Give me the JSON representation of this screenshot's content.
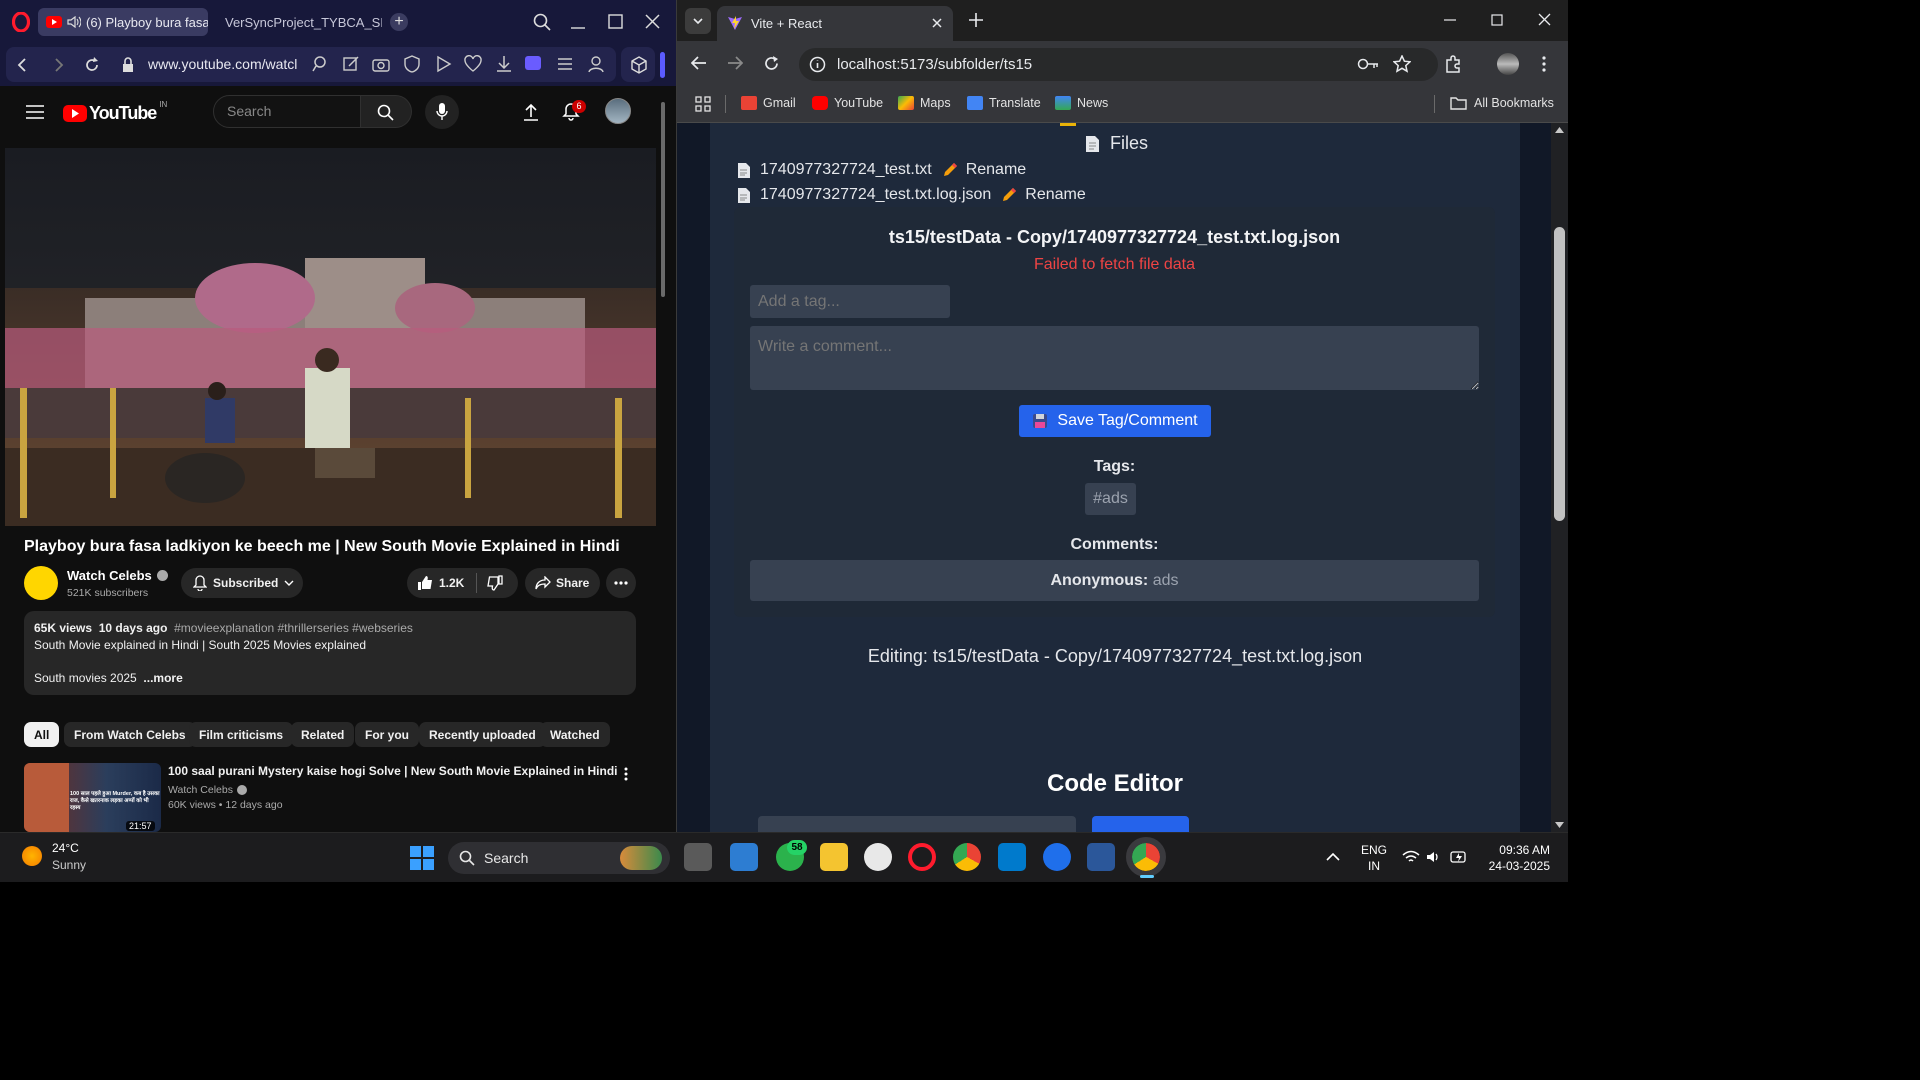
{
  "opera": {
    "tabs": [
      {
        "title": "(6) Playboy bura fasa l"
      },
      {
        "title": "VerSyncProject_TYBCA_SE"
      }
    ],
    "address": "www.youtube.com/watcl"
  },
  "youtube": {
    "logo_text": "YouTube",
    "region": "IN",
    "search_placeholder": "Search",
    "notification_count": "6",
    "video_title": "Playboy bura fasa ladkiyon ke beech me | New South Movie Explained in Hindi",
    "channel_name": "Watch Celebs",
    "subscribers": "521K subscribers",
    "subscribed_label": "Subscribed",
    "like_count": "1.2K",
    "share_label": "Share",
    "views": "65K views",
    "posted": "10 days ago",
    "hashtags": "#movieexplanation #thrillerseries #webseries",
    "description_line1": "South Movie explained in Hindi | South 2025 Movies explained",
    "description_line2": "South movies 2025",
    "more_label": "...more",
    "chips": [
      "All",
      "From Watch Celebs",
      "Film criticisms",
      "Related",
      "For you",
      "Recently uploaded",
      "Watched"
    ],
    "recommendation": {
      "title": "100 saal purani Mystery kaise hogi Solve | New South Movie Explained in Hindi",
      "channel": "Watch Celebs",
      "meta": "60K views • 12 days ago",
      "duration": "21:57",
      "thumb_text": "100 साल पहले हुआ Murder, कब है उसका राज, कैसे खतरनाक लड़का अप्पों को भी रहस्य"
    }
  },
  "chrome": {
    "tab_title": "Vite + React",
    "url": "localhost:5173/subfolder/ts15",
    "bookmarks": [
      {
        "label": "Gmail",
        "color": "#ea4335"
      },
      {
        "label": "YouTube",
        "color": "#ff0000"
      },
      {
        "label": "Maps",
        "color": "#34a853"
      },
      {
        "label": "Translate",
        "color": "#4285f4"
      },
      {
        "label": "News",
        "color": "#4285f4"
      }
    ],
    "all_bookmarks": "All Bookmarks"
  },
  "app": {
    "files_heading": "Files",
    "files": [
      {
        "name": "1740977327724_test.txt",
        "rename": "Rename"
      },
      {
        "name": "1740977327724_test.txt.log.json",
        "rename": "Rename"
      }
    ],
    "card_title": "ts15/testData - Copy/1740977327724_test.txt.log.json",
    "error": "Failed to fetch file data",
    "tag_placeholder": "Add a tag...",
    "comment_placeholder": "Write a comment...",
    "save_button": "Save Tag/Comment",
    "tags_label": "Tags:",
    "tags": [
      "#ads"
    ],
    "comments_label": "Comments:",
    "comments": [
      {
        "author": "Anonymous:",
        "text": "ads"
      }
    ],
    "editing": "Editing: ts15/testData - Copy/1740977327724_test.txt.log.json",
    "code_editor_heading": "Code Editor"
  },
  "taskbar": {
    "temperature": "24°C",
    "weather": "Sunny",
    "search_label": "Search",
    "whatsapp_badge": "58",
    "lang_top": "ENG",
    "lang_bottom": "IN",
    "time": "09:36 AM",
    "date": "24-03-2025"
  },
  "colors": {
    "opera_bar": "#17183a",
    "yt_red": "#ff0000",
    "app_bg": "#1e293b",
    "card_bg": "#1f2937",
    "input_bg": "#374151",
    "button_blue": "#2563eb",
    "error_red": "#ef4444"
  }
}
